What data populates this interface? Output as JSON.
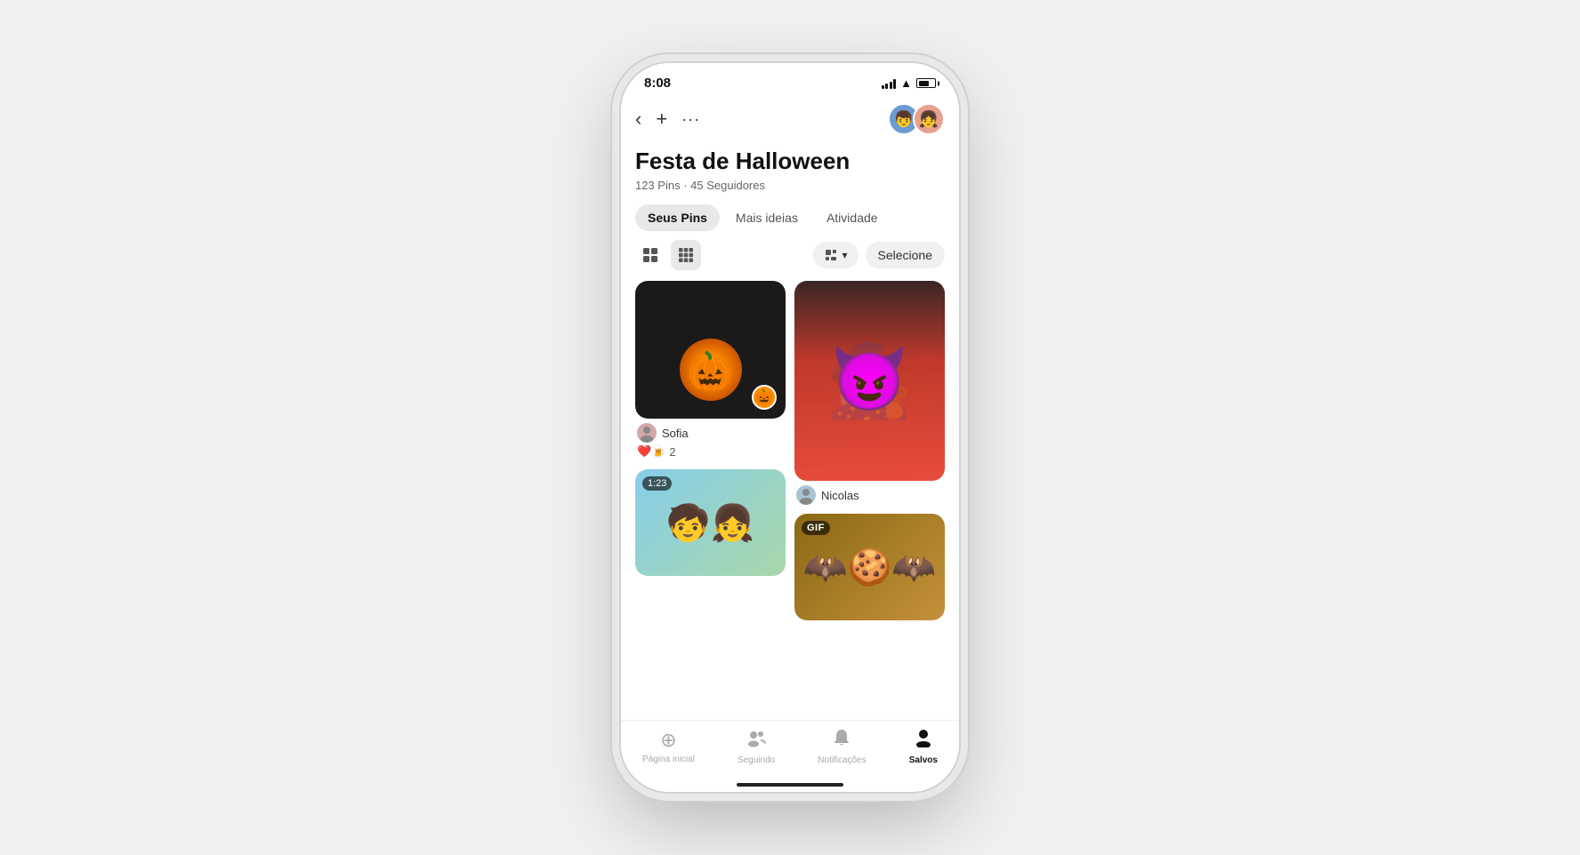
{
  "status_bar": {
    "time": "8:08"
  },
  "header": {
    "back_label": "‹",
    "add_label": "+",
    "more_label": "···"
  },
  "board": {
    "title": "Festa de Halloween",
    "meta": "123 Pins · 45 Seguidores"
  },
  "tabs": [
    {
      "id": "seus-pins",
      "label": "Seus Pins",
      "active": true
    },
    {
      "id": "mais-ideias",
      "label": "Mais ideias",
      "active": false
    },
    {
      "id": "atividade",
      "label": "Atividade",
      "active": false
    }
  ],
  "toolbar": {
    "select_label": "Selecione"
  },
  "pins": [
    {
      "id": "pumpkin",
      "type": "pumpkin",
      "user": "Sofia",
      "reactions": "❤️🍺 2",
      "badge": "🎃",
      "column": "left"
    },
    {
      "id": "witch-girl",
      "type": "witch",
      "user": "Nicolas",
      "column": "right"
    },
    {
      "id": "kids-playing",
      "type": "kids",
      "duration": "1:23",
      "column": "left"
    },
    {
      "id": "cookies",
      "type": "cookies",
      "gif": "GIF",
      "column": "right"
    }
  ],
  "bottom_nav": [
    {
      "id": "home",
      "label": "Página inicial",
      "icon": "⊕",
      "active": false
    },
    {
      "id": "following",
      "label": "Seguindo",
      "icon": "👥",
      "active": false
    },
    {
      "id": "notifications",
      "label": "Notificações",
      "icon": "🔔",
      "active": false
    },
    {
      "id": "saved",
      "label": "Salvos",
      "icon": "👤",
      "active": true
    }
  ]
}
